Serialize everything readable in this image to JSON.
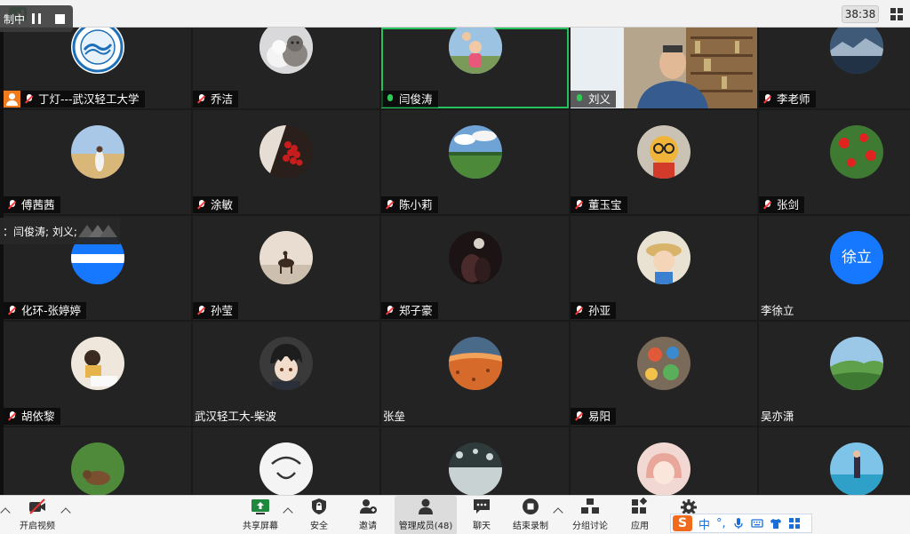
{
  "topbar": {
    "timer": "38:38"
  },
  "recording": {
    "label": "制中"
  },
  "speaking": {
    "text": "：闫俊涛; 刘义;"
  },
  "participants": [
    {
      "name": "丁灯---武汉轻工大学",
      "mic": "muted",
      "host": true
    },
    {
      "name": "乔洁",
      "mic": "muted"
    },
    {
      "name": "闫俊涛",
      "mic": "live",
      "active": true
    },
    {
      "name": "刘义",
      "mic": "live",
      "video": true
    },
    {
      "name": "李老师",
      "mic": "muted"
    },
    {
      "name": "傅茜茜",
      "mic": "muted"
    },
    {
      "name": "涂敏",
      "mic": "muted"
    },
    {
      "name": "陈小莉",
      "mic": "muted"
    },
    {
      "name": "董玉宝",
      "mic": "muted"
    },
    {
      "name": "张剑",
      "mic": "muted"
    },
    {
      "name": "化环-张婷婷",
      "mic": "muted"
    },
    {
      "name": "孙莹",
      "mic": "muted"
    },
    {
      "name": "郑子豪",
      "mic": "muted"
    },
    {
      "name": "孙亚",
      "mic": "muted"
    },
    {
      "name": "李徐立",
      "mic": "none",
      "initials": "徐立"
    },
    {
      "name": "胡依黎",
      "mic": "muted"
    },
    {
      "name": "武汉轻工大-柴波",
      "mic": "none"
    },
    {
      "name": "张垒",
      "mic": "none"
    },
    {
      "name": "易阳",
      "mic": "muted"
    },
    {
      "name": "吴亦潇",
      "mic": "none"
    }
  ],
  "toolbar": {
    "video": "开启视频",
    "share": "共享屏幕",
    "security": "安全",
    "invite": "邀请",
    "members": "管理成员(48)",
    "chat": "聊天",
    "record": "结束录制",
    "breakout": "分组讨论",
    "apps": "应用"
  },
  "ime": {
    "mode": "中",
    "punct": "°,"
  },
  "colors": {
    "active_border": "#23c25c",
    "muted_mic": "#ff3b3b",
    "avatar_blue": "#1677ff",
    "host_badge": "#f07b1d"
  }
}
